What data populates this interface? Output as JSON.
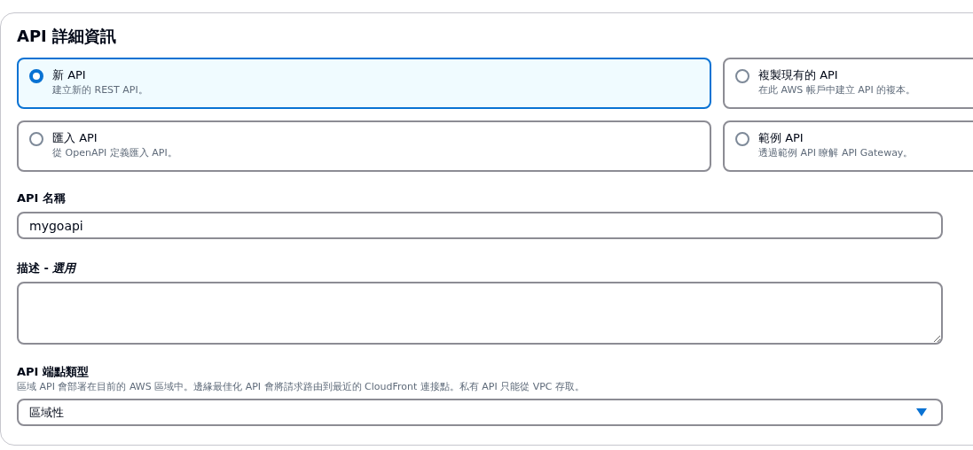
{
  "section": {
    "title": "API 詳細資訊"
  },
  "api_options": [
    {
      "label": "新 API",
      "description": "建立新的 REST API。",
      "selected": true
    },
    {
      "label": "複製現有的 API",
      "description": "在此 AWS 帳戶中建立 API 的複本。",
      "selected": false
    },
    {
      "label": "匯入 API",
      "description": "從 OpenAPI 定義匯入 API。",
      "selected": false
    },
    {
      "label": "範例 API",
      "description": "透過範例 API 瞭解 API Gateway。",
      "selected": false
    }
  ],
  "api_name": {
    "label": "API 名稱",
    "value": "mygoapi"
  },
  "description": {
    "label": "描述 - *選用*"
  },
  "endpoint_type": {
    "label": "API 端點類型",
    "hint": "區域 API 會部署在目前的 AWS 區域中。邊緣最佳化 API 會將請求路由到最近的 CloudFront 連接點。私有 API 只能從 VPC 存取。",
    "value": "區域性"
  }
}
